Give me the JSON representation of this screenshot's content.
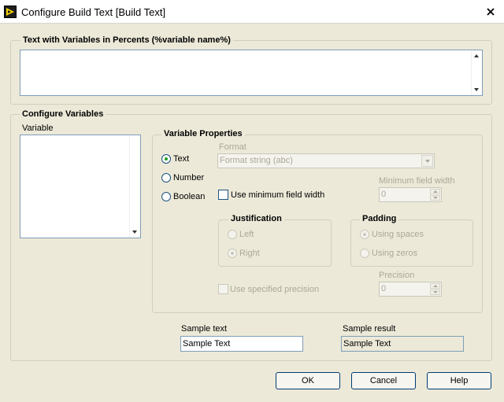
{
  "window": {
    "title": "Configure Build Text [Build Text]"
  },
  "text_section": {
    "label": "Text with Variables in Percents (%variable name%)",
    "value": ""
  },
  "configure": {
    "label": "Configure Variables",
    "variable_list_label": "Variable",
    "variables": []
  },
  "properties": {
    "label": "Variable Properties",
    "type_options": [
      {
        "label": "Text",
        "selected": true
      },
      {
        "label": "Number",
        "selected": false
      },
      {
        "label": "Boolean",
        "selected": false
      }
    ],
    "format_label": "Format",
    "format_value": "Format string  (abc)",
    "use_min_width_label": "Use minimum field width",
    "min_width_label": "Minimum field width",
    "min_width_value": "0",
    "justification": {
      "label": "Justification",
      "left": "Left",
      "right": "Right",
      "selected": "right"
    },
    "padding": {
      "label": "Padding",
      "spaces": "Using spaces",
      "zeros": "Using zeros",
      "selected": "spaces"
    },
    "use_precision_label": "Use specified precision",
    "precision_label": "Precision",
    "precision_value": "0"
  },
  "sample": {
    "text_label": "Sample text",
    "text_value": "Sample Text",
    "result_label": "Sample result",
    "result_value": "Sample Text"
  },
  "buttons": {
    "ok": "OK",
    "cancel": "Cancel",
    "help": "Help"
  },
  "colors": {
    "background": "#ece9d8",
    "radio_selected": "#21a121",
    "input_border": "#7f9db9",
    "button_border": "#003c74",
    "disabled_text": "#aca899"
  }
}
